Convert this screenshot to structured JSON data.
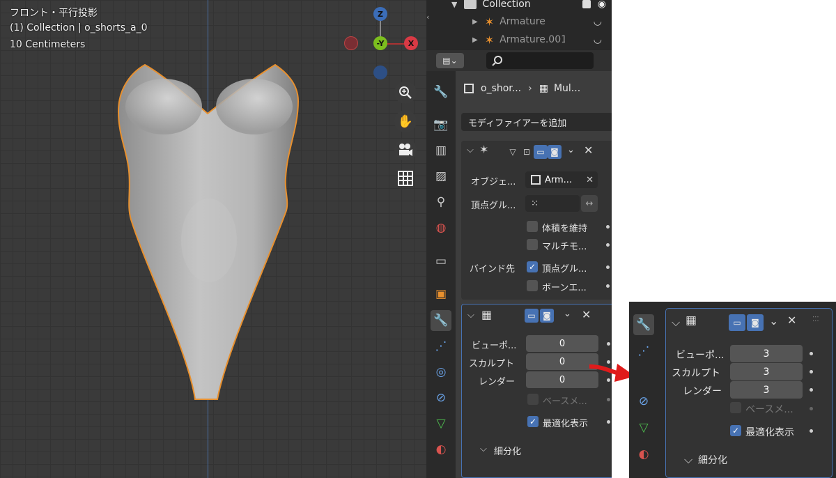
{
  "viewport": {
    "title": "フロント・平行投影",
    "collection": "(1) Collection | o_shorts_a_0",
    "unit": "10 Centimeters",
    "gizmo": {
      "z": "Z",
      "y": "-Y",
      "x": "X"
    }
  },
  "outliner": {
    "rows": [
      {
        "label": "Collection"
      },
      {
        "label": "Armature"
      },
      {
        "label": "Armature.001"
      }
    ]
  },
  "properties": {
    "breadcrumb": {
      "object": "o_shor...",
      "modifier": "Mul..."
    },
    "add_modifier": "モディファイアーを追加",
    "armature": {
      "object_label": "オブジェ...",
      "object_value": "Arm...",
      "vgroup_label": "頂点グル...",
      "preserve_volume": "体積を維持",
      "multi_modifier": "マルチモ...",
      "bind_to": "バインド先",
      "vertex_groups": "頂点グル...",
      "bone_envelopes": "ボーンエ..."
    },
    "multires": {
      "viewport_label": "ビューポ...",
      "viewport_value": "0",
      "sculpt_label": "スカルプト",
      "sculpt_value": "0",
      "render_label": "レンダー",
      "render_value": "0",
      "base_mesh": "ベースメ...",
      "optimal_display": "最適化表示",
      "subdivision": "細分化"
    }
  },
  "inset": {
    "viewport_label": "ビューポ...",
    "viewport_value": "3",
    "sculpt_label": "スカルプト",
    "sculpt_value": "3",
    "render_label": "レンダー",
    "render_value": "3",
    "base_mesh": "ベースメ...",
    "optimal_display": "最適化表示",
    "subdivision": "細分化"
  },
  "colors": {
    "viewport_bg": "#3a3a3a",
    "panel_bg": "#3d3d3d",
    "accent": "#4772b3",
    "outline_orange": "#e8902e",
    "arrow_red": "#e01b1b"
  }
}
